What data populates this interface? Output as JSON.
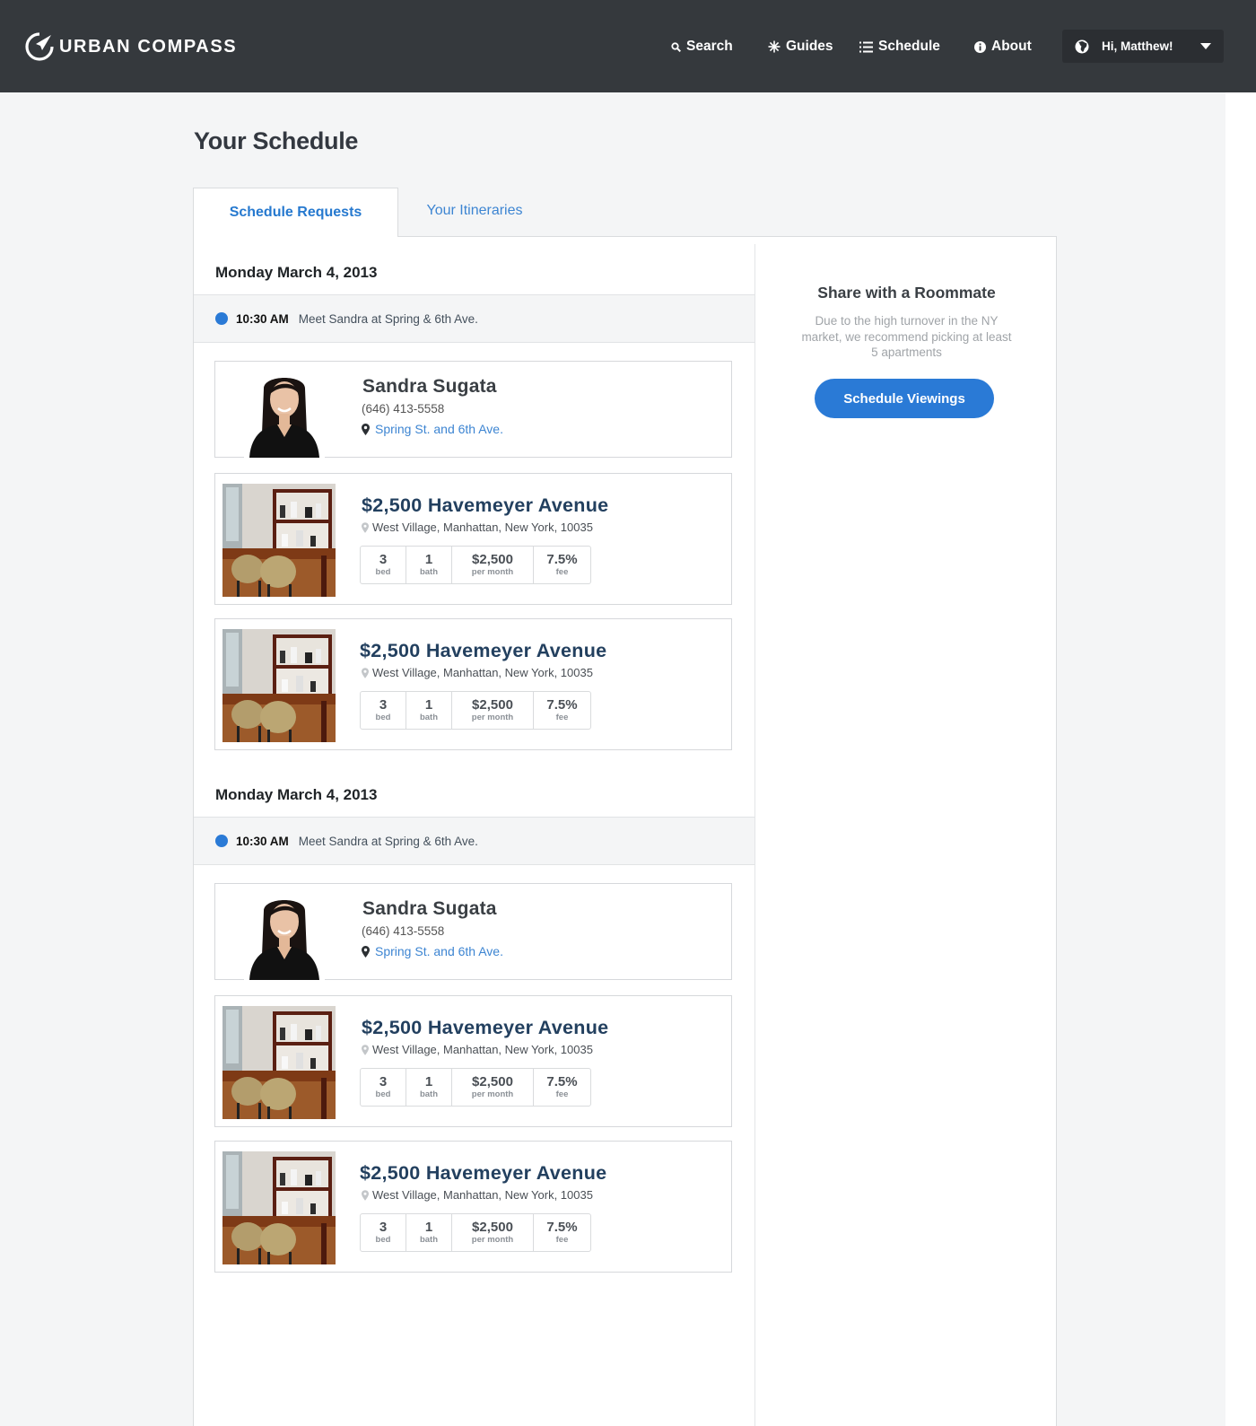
{
  "header": {
    "brand": "URBAN COMPASS",
    "nav": [
      {
        "label": "Search",
        "icon": "search-icon"
      },
      {
        "label": "Guides",
        "icon": "sparkle-icon"
      },
      {
        "label": "Schedule",
        "icon": "list-icon"
      },
      {
        "label": "About",
        "icon": "info-icon"
      }
    ],
    "user_greeting": "Hi, Matthew!"
  },
  "page": {
    "title": "Your Schedule",
    "tabs": [
      {
        "label": "Schedule Requests",
        "active": true
      },
      {
        "label": "Your Itineraries",
        "active": false
      }
    ]
  },
  "schedule": [
    {
      "date": "Monday March 4, 2013",
      "appointment": {
        "time": "10:30 AM",
        "desc": "Meet Sandra at Spring & 6th Ave."
      },
      "agent": {
        "name": "Sandra Sugata",
        "phone": "(646) 413-5558",
        "location": "Spring St. and 6th Ave."
      },
      "listings": [
        {
          "title": "$2,500 Havemeyer Avenue",
          "address": "West Village, Manhattan, New York, 10035",
          "stats": [
            {
              "v": "3",
              "l": "bed"
            },
            {
              "v": "1",
              "l": "bath"
            },
            {
              "v": "$2,500",
              "l": "per month"
            },
            {
              "v": "7.5%",
              "l": "fee"
            }
          ]
        },
        {
          "title": "$2,500 Havemeyer Avenue",
          "address": "West Village, Manhattan, New York, 10035",
          "stats": [
            {
              "v": "3",
              "l": "bed"
            },
            {
              "v": "1",
              "l": "bath"
            },
            {
              "v": "$2,500",
              "l": "per month"
            },
            {
              "v": "7.5%",
              "l": "fee"
            }
          ]
        }
      ]
    },
    {
      "date": "Monday March 4, 2013",
      "appointment": {
        "time": "10:30 AM",
        "desc": "Meet Sandra at Spring & 6th Ave."
      },
      "agent": {
        "name": "Sandra Sugata",
        "phone": "(646) 413-5558",
        "location": "Spring St. and 6th Ave."
      },
      "listings": [
        {
          "title": "$2,500 Havemeyer Avenue",
          "address": "West Village, Manhattan, New York, 10035",
          "stats": [
            {
              "v": "3",
              "l": "bed"
            },
            {
              "v": "1",
              "l": "bath"
            },
            {
              "v": "$2,500",
              "l": "per month"
            },
            {
              "v": "7.5%",
              "l": "fee"
            }
          ]
        },
        {
          "title": "$2,500 Havemeyer Avenue",
          "address": "West Village, Manhattan, New York, 10035",
          "stats": [
            {
              "v": "3",
              "l": "bed"
            },
            {
              "v": "1",
              "l": "bath"
            },
            {
              "v": "$2,500",
              "l": "per month"
            },
            {
              "v": "7.5%",
              "l": "fee"
            }
          ]
        }
      ]
    }
  ],
  "sidebar": {
    "title": "Share with a Roommate",
    "description": "Due to the high turnover in the NY market, we recommend picking at least 5 apartments",
    "button": "Schedule Viewings"
  },
  "colors": {
    "header_bg": "#35393d",
    "accent": "#2a7ad6",
    "link": "#3d85d2",
    "listing_title": "#23405f"
  }
}
